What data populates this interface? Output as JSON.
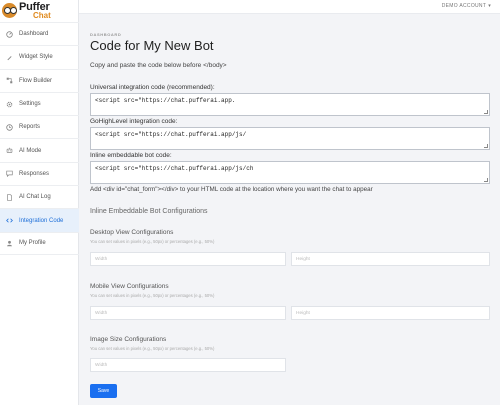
{
  "brand": {
    "line1": "Puffer",
    "line2": "Chat"
  },
  "header": {
    "account_label": "DEMO ACCOUNT",
    "account_caret": "▾"
  },
  "sidebar": {
    "items": [
      {
        "label": "Dashboard",
        "icon": "dashboard-icon"
      },
      {
        "label": "Widget Style",
        "icon": "brush-icon"
      },
      {
        "label": "Flow Builder",
        "icon": "flow-icon"
      },
      {
        "label": "Settings",
        "icon": "gear-icon"
      },
      {
        "label": "Reports",
        "icon": "clock-icon"
      },
      {
        "label": "AI Mode",
        "icon": "robot-icon"
      },
      {
        "label": "Responses",
        "icon": "chat-icon"
      },
      {
        "label": "AI Chat Log",
        "icon": "document-icon"
      },
      {
        "label": "Integration Code",
        "icon": "code-icon",
        "active": true
      },
      {
        "label": "My Profile",
        "icon": "user-icon"
      }
    ]
  },
  "page": {
    "breadcrumb": "DASHBOARD",
    "title": "Code for My New Bot",
    "subtitle": "Copy and paste the code below before </body>"
  },
  "codes": {
    "universal_label": "Universal integration code (recommended):",
    "universal_value": "<script src=\"https://chat.pufferai.app.",
    "gohighlevel_label": "GoHighLevel integration code:",
    "gohighlevel_value": "<script src=\"https://chat.pufferai.app/js/",
    "inline_label": "Inline embeddable bot code:",
    "inline_value": "<script src=\"https://chat.pufferai.app/js/ch",
    "inline_note": "Add <div id=\"chat_form\"></div> to your HTML code at the location where you want the chat to appear"
  },
  "config": {
    "section_title": "Inline Embeddable Bot Configurations",
    "desktop_title": "Desktop View Configurations",
    "desktop_hint": "You can set values in pixels (e.g., 50px) or percentages (e.g., 50%)",
    "desktop_width_placeholder": "Width",
    "desktop_height_placeholder": "Height",
    "mobile_title": "Mobile View Configurations",
    "mobile_hint": "You can set values in pixels (e.g., 50px) or percentages (e.g., 50%)",
    "mobile_width_placeholder": "Width",
    "mobile_height_placeholder": "Height",
    "image_title": "Image Size Configurations",
    "image_hint": "You can set values in pixels (e.g., 50px) or percentages (e.g., 50%)",
    "image_width_placeholder": "Width",
    "save_label": "Save"
  },
  "colors": {
    "accent": "#1a6ff0",
    "active_bg": "#e7f0fb",
    "brand_orange": "#e08a1e"
  }
}
